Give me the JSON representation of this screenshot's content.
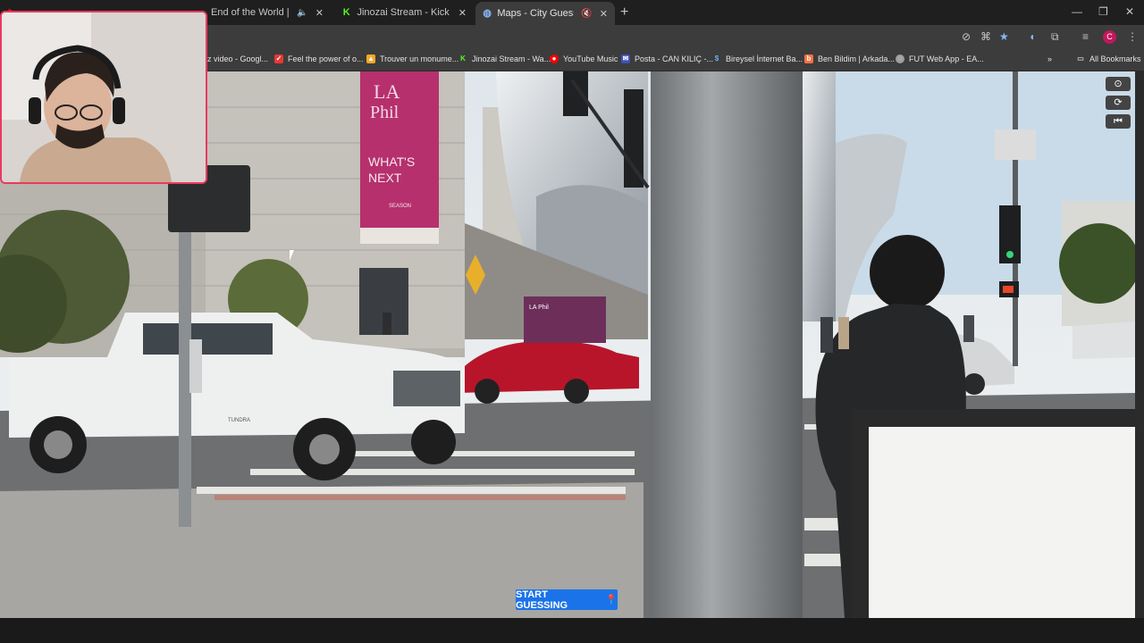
{
  "tabs": [
    {
      "label": "",
      "icon": "youtube-icon"
    },
    {
      "label": "End of the World | YouTube",
      "icon": "youtube-icon",
      "muted": true
    },
    {
      "label": "Jinozai Stream - Kick Dashboard",
      "icon": "kick-icon"
    },
    {
      "label": "Maps - City Guesser",
      "icon": "globe-icon",
      "active": true
    }
  ],
  "bookmarks": [
    {
      "label": "z video - Googl...",
      "color": "#4285f4"
    },
    {
      "label": "Feel the power of o...",
      "color": "#e53935"
    },
    {
      "label": "Trouver un monume...",
      "color": "#f9a825"
    },
    {
      "label": "Jinozai Stream - Wa...",
      "color": "#53fc18"
    },
    {
      "label": "YouTube Music",
      "color": "#ff0000"
    },
    {
      "label": "Posta - CAN KILIÇ -...",
      "color": "#3f51b5"
    },
    {
      "label": "Bireysel İnternet Ba...",
      "color": "#1e88e5"
    },
    {
      "label": "Ben Bildim | Arkada...",
      "color": "#ff7043"
    },
    {
      "label": "FUT Web App - EA...",
      "color": "#9e9e9e"
    }
  ],
  "all_bookmarks_label": "All Bookmarks",
  "profile_initial": "C",
  "game": {
    "start_button": "START GUESSING",
    "controls": [
      "compass-icon",
      "refresh-icon",
      "skip-back-icon"
    ]
  },
  "scene_signs": {
    "banner_line1": "LA",
    "banner_line2": "Phil",
    "banner_line3": "WHAT'S",
    "banner_line4": "NEXT",
    "banner_line5": "SEASON",
    "truck_badge": "TUNDRA",
    "poster": "LA Phil"
  }
}
